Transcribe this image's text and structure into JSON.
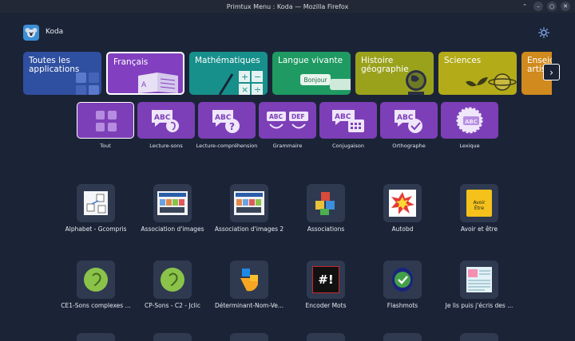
{
  "window": {
    "title": "Primtux Menu : Koda — Mozilla Firefox"
  },
  "header": {
    "user_name": "Koda"
  },
  "categories": [
    {
      "label": "Toutes les applications",
      "color": "#2f4fa0",
      "selected": false
    },
    {
      "label": "Français",
      "color": "#8240c0",
      "selected": true
    },
    {
      "label": "Mathématiques",
      "color": "#17908c",
      "selected": false
    },
    {
      "label": "Langue vivante",
      "color": "#1e9a62",
      "selected": false,
      "badge_text": "Bonjour"
    },
    {
      "label": "Histoire géographie",
      "color": "#9aa21c",
      "selected": false
    },
    {
      "label": "Sciences",
      "color": "#b3ab18",
      "selected": false
    },
    {
      "label": "Enseignements artistiques",
      "color": "#d18a1e",
      "selected": false
    }
  ],
  "subcategories": [
    {
      "label": "Tout",
      "selected": true,
      "icon": "grid-icon"
    },
    {
      "label": "Lecture-sons",
      "selected": false,
      "icon": "abc-ear-icon"
    },
    {
      "label": "Lecture-compréhension",
      "selected": false,
      "icon": "abc-question-icon"
    },
    {
      "label": "Grammaire",
      "selected": false,
      "icon": "abc-def-icon"
    },
    {
      "label": "Conjugaison",
      "selected": false,
      "icon": "abc-calendar-icon"
    },
    {
      "label": "Orthographe",
      "selected": false,
      "icon": "abc-check-icon"
    },
    {
      "label": "Lexique",
      "selected": false,
      "icon": "abc-gear-icon"
    }
  ],
  "apps": [
    {
      "name": "Alphabet - Gcompris",
      "icon": "alphabet-blocks-icon"
    },
    {
      "name": "Association d'images",
      "icon": "picture-board-icon"
    },
    {
      "name": "Association d'images 2",
      "icon": "picture-board-icon"
    },
    {
      "name": "Associations",
      "icon": "letter-cubes-icon"
    },
    {
      "name": "Autobd",
      "icon": "comic-burst-icon"
    },
    {
      "name": "Avoir et être",
      "icon": "avoir-etre-icon",
      "tile_text": "Avoir\nÊtre"
    },
    {
      "name": "CE1-Sons complexes ...",
      "icon": "green-ear-icon"
    },
    {
      "name": "CP-Sons - C2 - Jclic",
      "icon": "green-ear-icon"
    },
    {
      "name": "Déterminant-Nom-Ve...",
      "icon": "shapes-puzzle-icon"
    },
    {
      "name": "Encoder Mots",
      "icon": "hash-exclaim-icon",
      "tile_text": "#!"
    },
    {
      "name": "Flashmots",
      "icon": "check-badge-icon"
    },
    {
      "name": "Je lis puis j'écris des ...",
      "icon": "worksheet-icon"
    }
  ]
}
